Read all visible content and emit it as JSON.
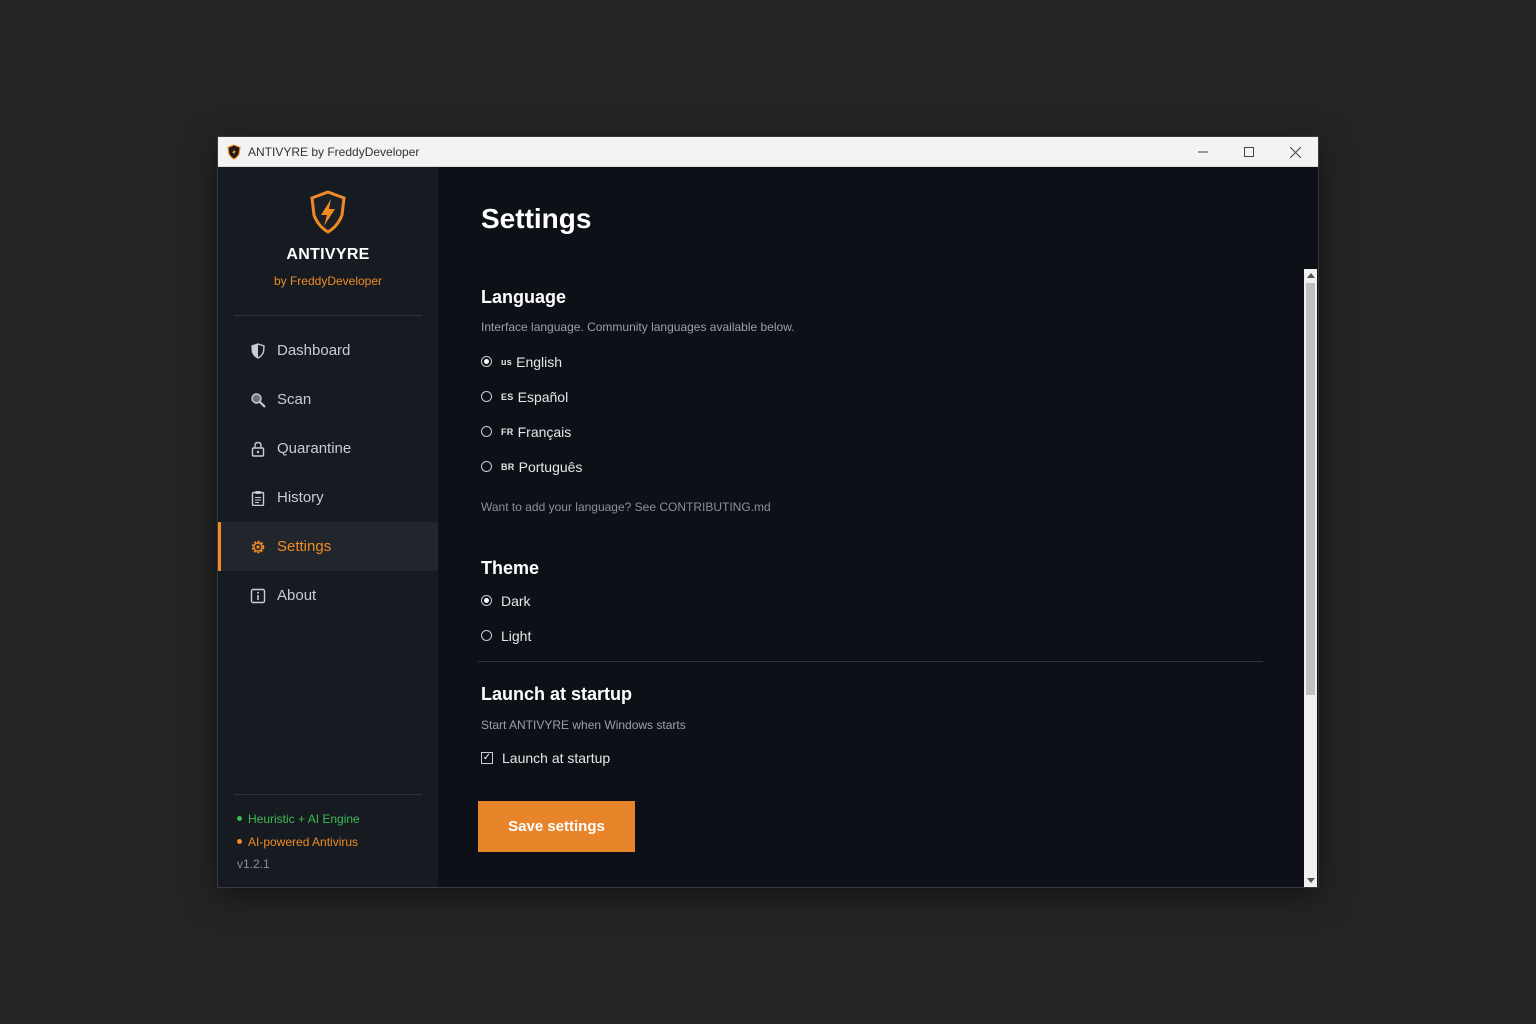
{
  "window": {
    "title": "ANTIVYRE by FreddyDeveloper"
  },
  "sidebar": {
    "brand": {
      "name": "ANTIVYRE",
      "by": "by FreddyDeveloper"
    },
    "items": [
      {
        "label": "Dashboard",
        "icon": "shield-icon"
      },
      {
        "label": "Scan",
        "icon": "magnifier-icon"
      },
      {
        "label": "Quarantine",
        "icon": "lock-icon"
      },
      {
        "label": "History",
        "icon": "clipboard-icon"
      },
      {
        "label": "Settings",
        "icon": "gear-icon",
        "active": true
      },
      {
        "label": "About",
        "icon": "info-icon"
      }
    ],
    "footer": {
      "engine": "Heuristic + AI Engine",
      "tagline": "AI-powered Antivirus",
      "version": "v1.2.1"
    }
  },
  "colors": {
    "accent": "#f08a24",
    "green": "#3fb950",
    "background": "#0d1117",
    "sidebar": "#161b22"
  },
  "main": {
    "title": "Settings",
    "language": {
      "title": "Language",
      "description": "Interface language. Community languages available below.",
      "options": [
        {
          "flag": "us",
          "label": "English",
          "selected": true
        },
        {
          "flag": "ES",
          "label": "Español",
          "selected": false
        },
        {
          "flag": "FR",
          "label": "Français",
          "selected": false
        },
        {
          "flag": "BR",
          "label": "Português",
          "selected": false
        }
      ],
      "hint": "Want to add your language? See CONTRIBUTING.md"
    },
    "theme": {
      "title": "Theme",
      "options": [
        {
          "label": "Dark",
          "selected": true
        },
        {
          "label": "Light",
          "selected": false
        }
      ]
    },
    "startup": {
      "title": "Launch at startup",
      "description": "Start ANTIVYRE when Windows starts",
      "checkbox_label": "Launch at startup",
      "checked": true
    },
    "save_label": "Save settings"
  }
}
